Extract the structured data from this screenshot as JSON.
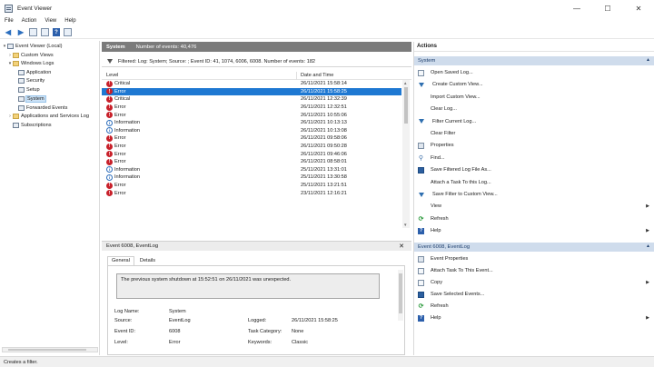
{
  "window": {
    "title": "Event Viewer",
    "controls": [
      "—",
      "☐",
      "✕"
    ]
  },
  "menu": [
    "File",
    "Action",
    "View",
    "Help"
  ],
  "tree": [
    {
      "label": "Event Viewer (Local)",
      "twisty": "▾",
      "depth": 0,
      "selected": false
    },
    {
      "label": "Custom Views",
      "twisty": "›",
      "depth": 1,
      "selected": false
    },
    {
      "label": "Windows Logs",
      "twisty": "▾",
      "depth": 1,
      "selected": false
    },
    {
      "label": "Application",
      "twisty": "",
      "depth": 2,
      "selected": false
    },
    {
      "label": "Security",
      "twisty": "",
      "depth": 2,
      "selected": false
    },
    {
      "label": "Setup",
      "twisty": "",
      "depth": 2,
      "selected": false
    },
    {
      "label": "System",
      "twisty": "",
      "depth": 2,
      "selected": true
    },
    {
      "label": "Forwarded Events",
      "twisty": "",
      "depth": 2,
      "selected": false
    },
    {
      "label": "Applications and Services Log",
      "twisty": "›",
      "depth": 1,
      "selected": false
    },
    {
      "label": "Subscriptions",
      "twisty": "",
      "depth": 1,
      "selected": false
    }
  ],
  "center": {
    "log_name": "System",
    "event_count": "Number of events: 40,476",
    "filter_text": "Filtered: Log: System; Source: ; Event ID: 41, 1074, 6006, 6008. Number of events: 182",
    "col_level": "Level",
    "col_datetime": "Date and Time"
  },
  "events": [
    {
      "level": "Critical",
      "type": "err",
      "datetime": "26/11/2021 15:58:14",
      "selected": false
    },
    {
      "level": "Error",
      "type": "err",
      "datetime": "26/11/2021 15:58:25",
      "selected": true
    },
    {
      "level": "Critical",
      "type": "err",
      "datetime": "26/11/2021 12:32:39",
      "selected": false
    },
    {
      "level": "Error",
      "type": "err",
      "datetime": "26/11/2021 12:32:51",
      "selected": false
    },
    {
      "level": "Error",
      "type": "err",
      "datetime": "26/11/2021 10:55:06",
      "selected": false
    },
    {
      "level": "Information",
      "type": "info",
      "datetime": "26/11/2021 10:13:13",
      "selected": false
    },
    {
      "level": "Information",
      "type": "info",
      "datetime": "26/11/2021 10:13:08",
      "selected": false
    },
    {
      "level": "Error",
      "type": "err",
      "datetime": "26/11/2021 09:58:06",
      "selected": false
    },
    {
      "level": "Error",
      "type": "err",
      "datetime": "26/11/2021 09:50:28",
      "selected": false
    },
    {
      "level": "Error",
      "type": "err",
      "datetime": "26/11/2021 09:46:06",
      "selected": false
    },
    {
      "level": "Error",
      "type": "err",
      "datetime": "26/11/2021 08:58:01",
      "selected": false
    },
    {
      "level": "Information",
      "type": "info",
      "datetime": "25/11/2021 13:31:01",
      "selected": false
    },
    {
      "level": "Information",
      "type": "info",
      "datetime": "25/11/2021 13:30:58",
      "selected": false
    },
    {
      "level": "Error",
      "type": "err",
      "datetime": "25/11/2021 13:21:51",
      "selected": false
    },
    {
      "level": "Error",
      "type": "err",
      "datetime": "23/11/2021 12:16:21",
      "selected": false
    }
  ],
  "detail": {
    "header": "Event 6008, EventLog",
    "close": "✕",
    "tab_general": "General",
    "tab_details": "Details",
    "description": "The previous system shutdown at 15:52:51 on 26/11/2021 was unexpected.",
    "k_logname": "Log Name:",
    "v_logname": "System",
    "k_source": "Source:",
    "v_source": "EventLog",
    "k_logged": "Logged:",
    "v_logged": "26/11/2021 15:58:25",
    "k_eventid": "Event ID:",
    "v_eventid": "6008",
    "k_taskcat": "Task Category:",
    "v_taskcat": "None",
    "k_level": "Level:",
    "v_level": "Error",
    "k_keywords": "Keywords:",
    "v_keywords": "Classic"
  },
  "actions": {
    "title": "Actions",
    "section1": "System",
    "section1_items": [
      {
        "label": "Open Saved Log...",
        "icon": "doc",
        "sub": false
      },
      {
        "label": "Create Custom View...",
        "icon": "funnel",
        "sub": false
      },
      {
        "label": "Import Custom View...",
        "icon": "none",
        "sub": false
      },
      {
        "label": "Clear Log...",
        "icon": "none",
        "sub": false
      },
      {
        "label": "Filter Current Log...",
        "icon": "funnel",
        "sub": false
      },
      {
        "label": "Clear Filter",
        "icon": "none",
        "sub": false
      },
      {
        "label": "Properties",
        "icon": "props",
        "sub": false
      },
      {
        "label": "Find...",
        "icon": "find",
        "sub": false
      },
      {
        "label": "Save Filtered Log File As...",
        "icon": "save",
        "sub": false
      },
      {
        "label": "Attach a Task To this Log...",
        "icon": "none",
        "sub": false
      },
      {
        "label": "Save Filter to Custom View...",
        "icon": "funnel",
        "sub": false
      },
      {
        "label": "View",
        "icon": "none",
        "sub": true
      },
      {
        "label": "Refresh",
        "icon": "refresh",
        "sub": false
      },
      {
        "label": "Help",
        "icon": "help",
        "sub": true
      }
    ],
    "section2": "Event 6008, EventLog",
    "section2_items": [
      {
        "label": "Event Properties",
        "icon": "props",
        "sub": false
      },
      {
        "label": "Attach Task To This Event...",
        "icon": "doc",
        "sub": false
      },
      {
        "label": "Copy",
        "icon": "doc",
        "sub": true
      },
      {
        "label": "Save Selected Events...",
        "icon": "save",
        "sub": false
      },
      {
        "label": "Refresh",
        "icon": "refresh",
        "sub": false
      },
      {
        "label": "Help",
        "icon": "help",
        "sub": true
      }
    ]
  },
  "status": "Creates a filter."
}
